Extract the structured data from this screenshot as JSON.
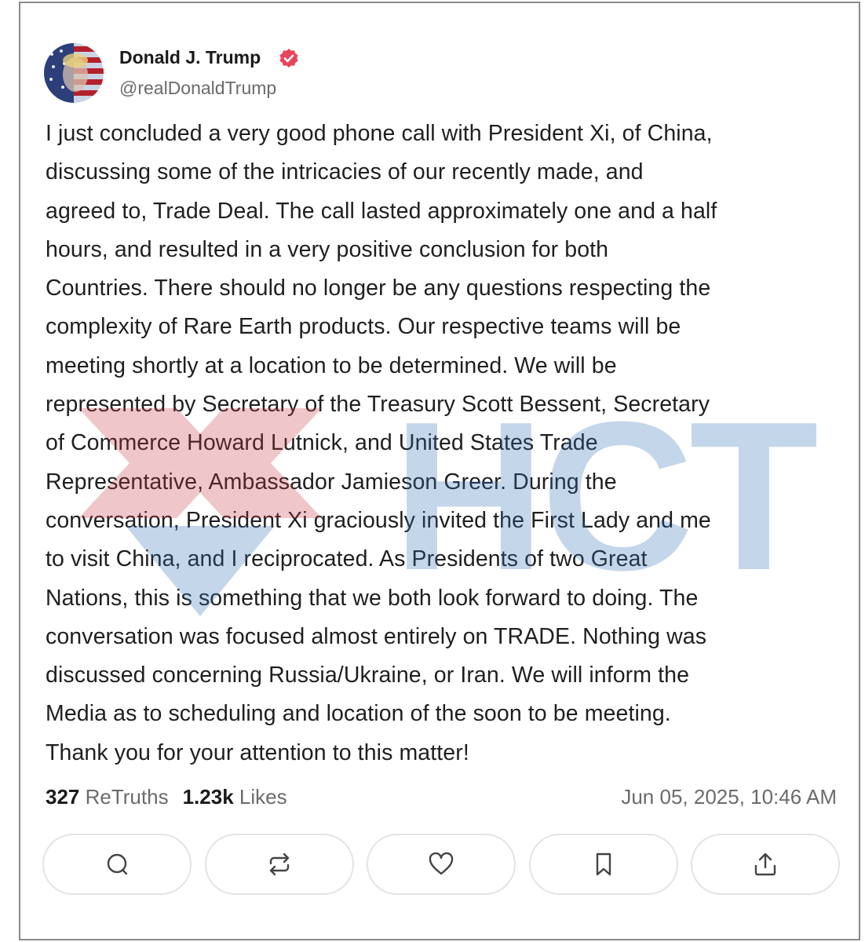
{
  "author": {
    "name": "Donald J. Trump",
    "handle": "@realDonaldTrump",
    "verified": true,
    "verified_color": "#e8455a",
    "avatar_icon": "flag-portrait-avatar"
  },
  "post": {
    "lines": [
      "I just concluded a very good phone call with President Xi, of China,",
      "discussing some of the intricacies of our recently made, and",
      "agreed to, Trade Deal. The call lasted approximately one and a half",
      "hours, and resulted in a very positive conclusion for both",
      "Countries. There should no longer be any questions respecting the",
      "complexity of Rare Earth products. Our respective teams will be",
      "meeting shortly at a location to be determined. We will be",
      "represented by Secretary of the Treasury Scott Bessent, Secretary",
      "of Commerce Howard Lutnick, and United States Trade",
      "Representative, Ambassador Jamieson Greer. During the",
      "conversation, President Xi graciously invited the First Lady and me",
      "to visit China, and I reciprocated. As Presidents of two Great",
      "Nations, this is something that we both look forward to doing. The",
      "conversation was focused almost entirely on TRADE. Nothing was",
      "discussed concerning Russia/Ukraine, or Iran. We will inform the",
      "Media as to scheduling and location of the soon to be meeting.",
      "Thank you for your attention to this matter!"
    ]
  },
  "stats": {
    "retruths_count": "327",
    "retruths_label": "ReTruths",
    "likes_count": "1.23k",
    "likes_label": "Likes",
    "timestamp": "Jun 05, 2025, 10:46 AM"
  },
  "watermark": {
    "text": "HCT",
    "text_color": "#2f6fb5",
    "diamond_color": "#c8373f"
  },
  "actions": [
    {
      "icon": "reply-icon"
    },
    {
      "icon": "retruth-icon"
    },
    {
      "icon": "heart-icon"
    },
    {
      "icon": "bookmark-icon"
    },
    {
      "icon": "share-icon"
    }
  ]
}
